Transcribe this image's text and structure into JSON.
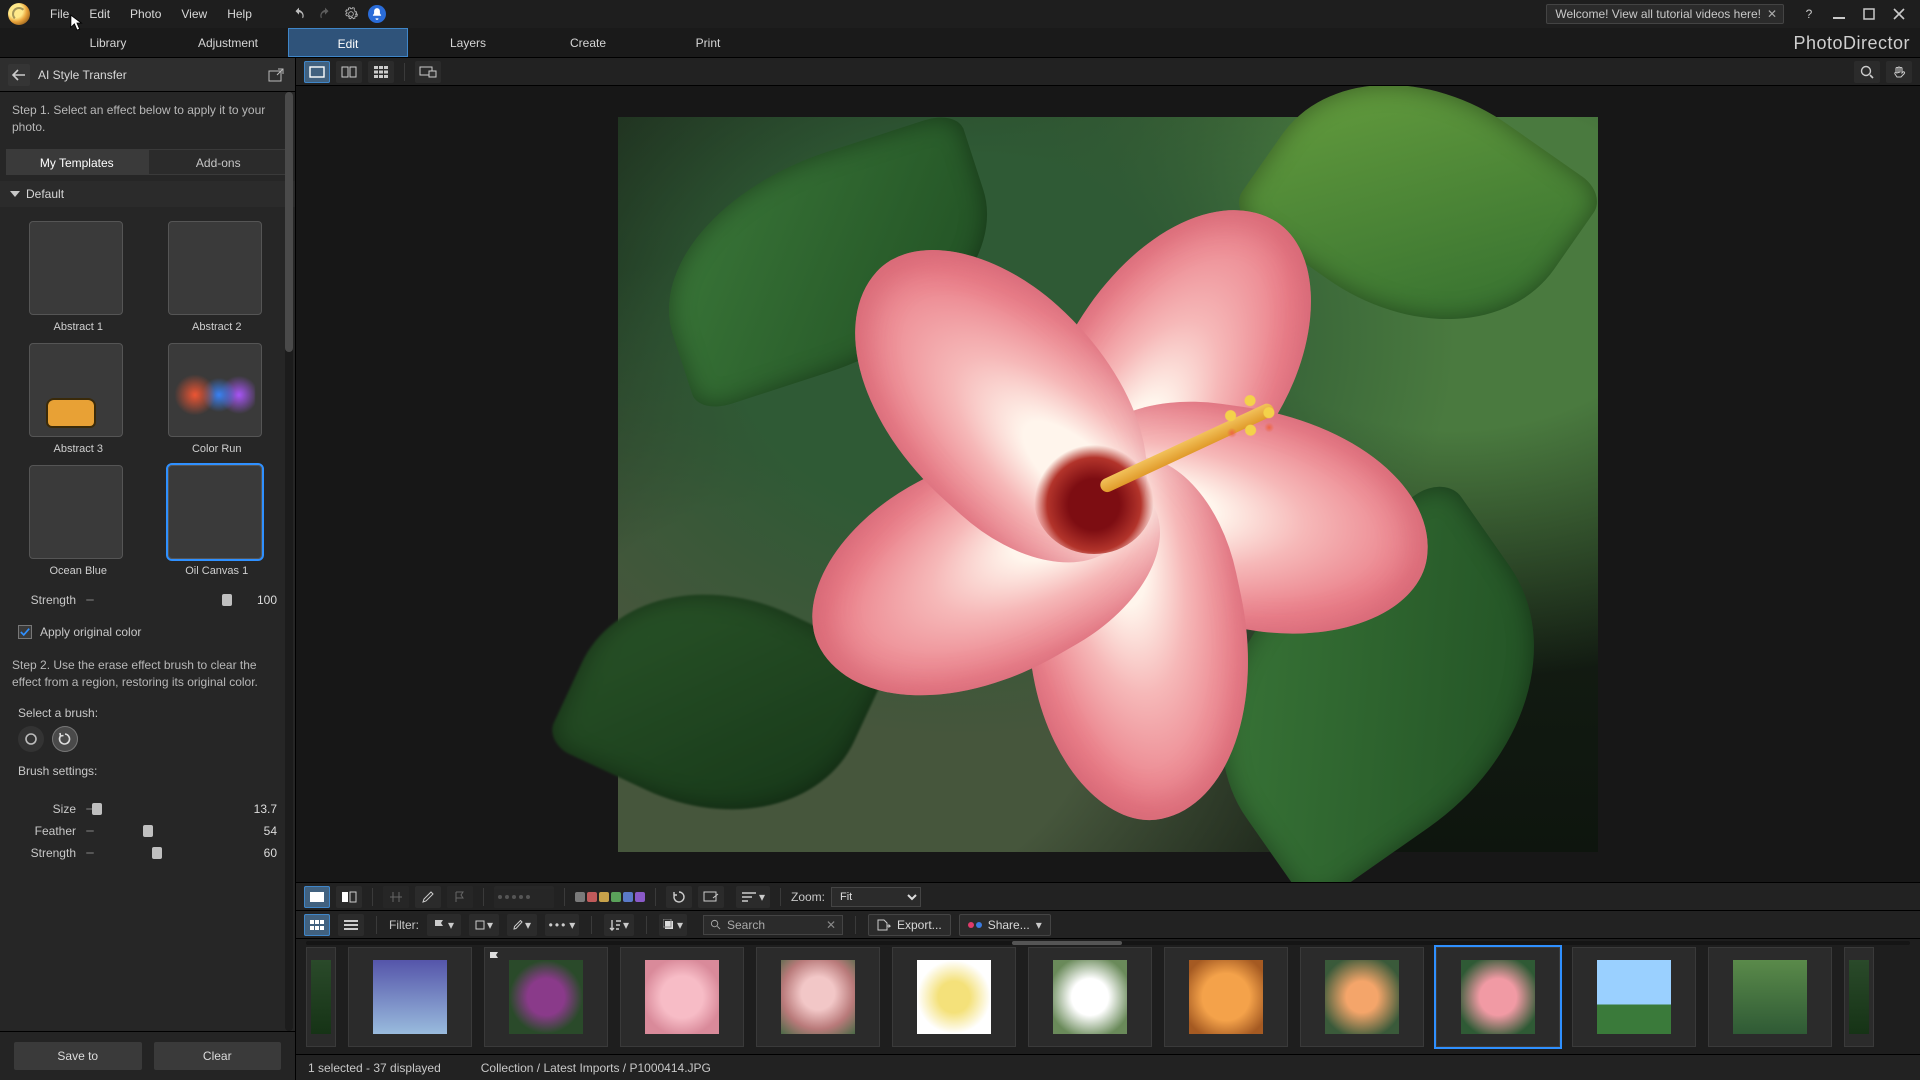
{
  "menu": {
    "file": "File",
    "edit": "Edit",
    "photo": "Photo",
    "view": "View",
    "help": "Help"
  },
  "welcome": "Welcome! View all tutorial videos here!",
  "brand": "PhotoDirector",
  "modules": {
    "library": "Library",
    "adjustment": "Adjustment",
    "edit": "Edit",
    "layers": "Layers",
    "create": "Create",
    "print": "Print"
  },
  "panel": {
    "title": "AI Style Transfer",
    "step1": "Step 1. Select an effect below to apply it to your photo.",
    "tabs": {
      "my": "My Templates",
      "addons": "Add-ons"
    },
    "section": "Default",
    "templates": [
      {
        "name": "Abstract 1"
      },
      {
        "name": "Abstract 2"
      },
      {
        "name": "Abstract 3"
      },
      {
        "name": "Color Run"
      },
      {
        "name": "Ocean Blue"
      },
      {
        "name": "Oil Canvas 1"
      }
    ],
    "strength_label": "Strength",
    "strength_value": "100",
    "apply_original": "Apply original color",
    "step2": "Step 2. Use the erase effect brush to clear the effect from a region, restoring its original color.",
    "select_brush": "Select a brush:",
    "brush_settings": "Brush settings:",
    "size_label": "Size",
    "size_value": "13.7",
    "feather_label": "Feather",
    "feather_value": "54",
    "bstrength_label": "Strength",
    "bstrength_value": "60",
    "save_to": "Save to",
    "clear": "Clear"
  },
  "imgbar": {
    "swatches": [
      "#7a7a7a",
      "#c05a5a",
      "#c8a24a",
      "#5aa25a",
      "#5a7ac8",
      "#8a5ac8"
    ],
    "zoom_label": "Zoom:",
    "zoom_value": "Fit"
  },
  "filter": {
    "label": "Filter:",
    "search_placeholder": "Search",
    "export": "Export...",
    "share": "Share..."
  },
  "status": {
    "left": "1 selected - 37 displayed",
    "path": "Collection / Latest Imports / P1000414.JPG"
  }
}
